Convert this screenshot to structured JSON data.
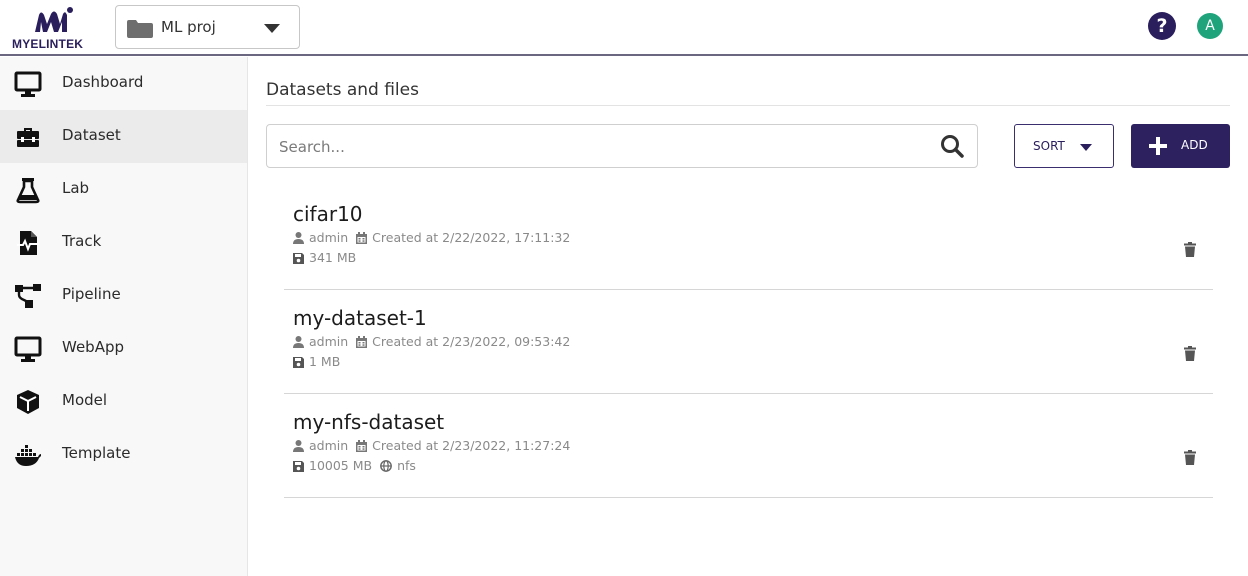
{
  "header": {
    "logo_text": "MYELINTEK",
    "project_name": "ML proj",
    "help_label": "?",
    "avatar_initial": "A"
  },
  "sidebar": {
    "items": [
      {
        "label": "Dashboard",
        "icon": "monitor-icon"
      },
      {
        "label": "Dataset",
        "icon": "toolbox-icon",
        "active": true
      },
      {
        "label": "Lab",
        "icon": "flask-icon"
      },
      {
        "label": "Track",
        "icon": "heartbeat-file-icon"
      },
      {
        "label": "Pipeline",
        "icon": "pipeline-icon"
      },
      {
        "label": "WebApp",
        "icon": "monitor-icon"
      },
      {
        "label": "Model",
        "icon": "cube-icon"
      },
      {
        "label": "Template",
        "icon": "docker-icon"
      }
    ]
  },
  "main": {
    "title": "Datasets and files",
    "search_placeholder": "Search...",
    "sort_label": "SORT",
    "add_label": "ADD"
  },
  "datasets": [
    {
      "name": "cifar10",
      "owner": "admin",
      "created": "Created at 2/22/2022, 17:11:32",
      "size": "341 MB",
      "protocol": ""
    },
    {
      "name": "my-dataset-1",
      "owner": "admin",
      "created": "Created at 2/23/2022, 09:53:42",
      "size": "1 MB",
      "protocol": ""
    },
    {
      "name": "my-nfs-dataset",
      "owner": "admin",
      "created": "Created at 2/23/2022, 11:27:24",
      "size": "10005 MB",
      "protocol": "nfs"
    }
  ],
  "colors": {
    "brand": "#2e2160",
    "avatar": "#1fa37a",
    "active_nav": "#ebebeb"
  }
}
